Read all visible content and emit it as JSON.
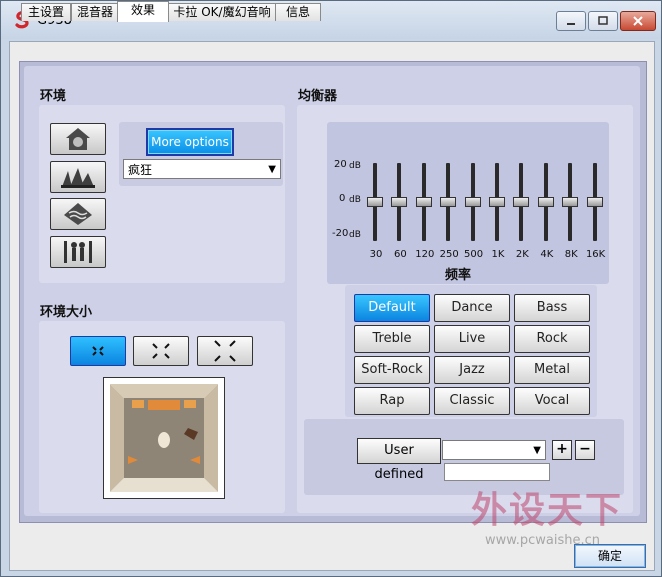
{
  "window": {
    "title": "G938"
  },
  "tabs": [
    "主设置",
    "混音器",
    "效果",
    "卡拉 OK/魔幻音响",
    "信息"
  ],
  "active_tab": 2,
  "environment": {
    "label": "环境",
    "icons": [
      "house-environment-icon",
      "concert-hall-icon",
      "underwater-icon",
      "stage-performers-icon"
    ],
    "more_options_label": "More options",
    "selected": "疯狂"
  },
  "environment_size": {
    "label": "环境大小",
    "buttons": [
      "small-size-icon",
      "medium-size-icon",
      "large-size-icon"
    ],
    "active_index": 0
  },
  "equalizer": {
    "label": "均衡器",
    "db_top": "20",
    "db_mid": "0",
    "db_bottom": "-20",
    "db_unit": "dB",
    "freq_axis_label": "频率",
    "bands": [
      "30",
      "60",
      "120",
      "250",
      "500",
      "1K",
      "2K",
      "4K",
      "8K",
      "16K"
    ],
    "band_values_db": [
      0,
      0,
      0,
      0,
      0,
      0,
      0,
      0,
      0,
      0
    ]
  },
  "presets": {
    "items": [
      "Default",
      "Dance",
      "Bass",
      "Treble",
      "Live",
      "Rock",
      "Soft-Rock",
      "Jazz",
      "Metal",
      "Rap",
      "Classic",
      "Vocal"
    ],
    "active": "Default"
  },
  "user_defined": {
    "label": "User defined",
    "selected": "",
    "name_value": "",
    "add_label": "+",
    "remove_label": "−"
  },
  "footer": {
    "ok_label": "确定"
  },
  "watermark": {
    "brand": "外设天下",
    "url": "www.pcwaishe.cn"
  },
  "colors": {
    "accent": "#13a0f0",
    "panel": "#cdd0e6",
    "close": "#c74a33"
  }
}
